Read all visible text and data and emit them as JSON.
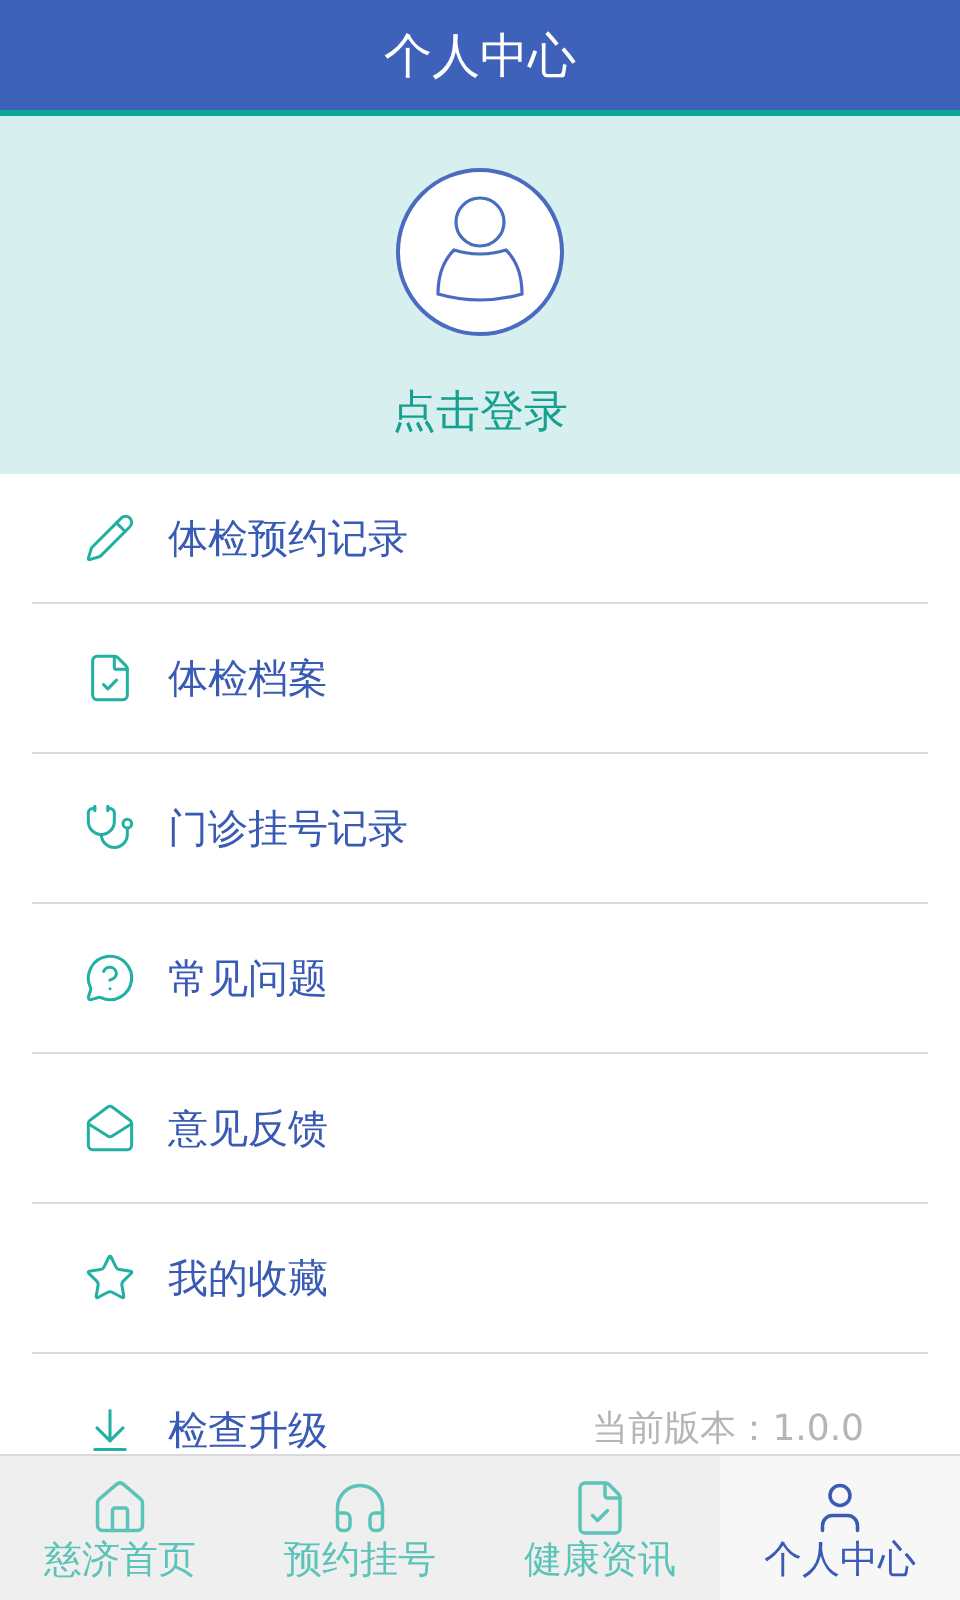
{
  "header": {
    "title": "个人中心"
  },
  "profile": {
    "login": "点击登录"
  },
  "menu": [
    {
      "kind": "pencil",
      "label": "体检预约记录"
    },
    {
      "kind": "document",
      "label": "体检档案"
    },
    {
      "kind": "stethoscope",
      "label": "门诊挂号记录"
    },
    {
      "kind": "question",
      "label": "常见问题"
    },
    {
      "kind": "mail",
      "label": "意见反馈"
    },
    {
      "kind": "star",
      "label": "我的收藏"
    },
    {
      "kind": "download",
      "label": "检查升级",
      "detail": "当前版本：1.0.0"
    }
  ],
  "tabs": [
    {
      "kind": "home",
      "label": "慈济首页",
      "selected": false
    },
    {
      "kind": "headset",
      "label": "预约挂号",
      "selected": false
    },
    {
      "kind": "document",
      "label": "健康资讯",
      "selected": false
    },
    {
      "kind": "user",
      "label": "个人中心",
      "selected": true
    }
  ]
}
